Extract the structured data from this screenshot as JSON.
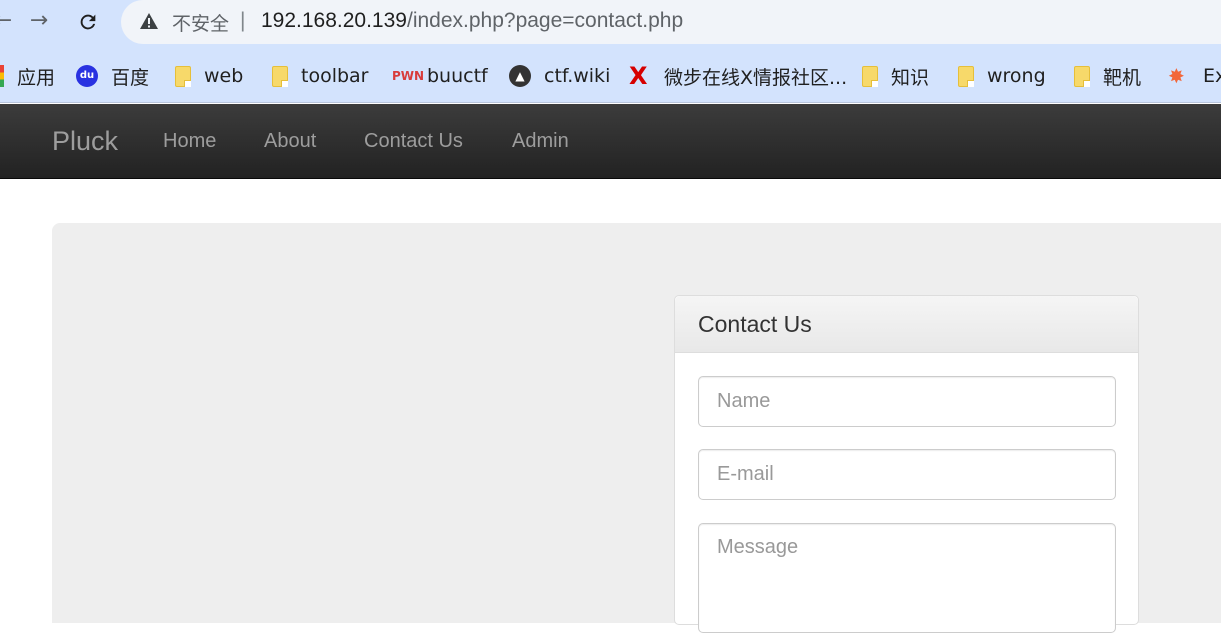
{
  "browser": {
    "security_label": "不安全",
    "url_host": "192.168.20.139",
    "url_path": "/index.php?page=contact.php",
    "bookmarks": [
      {
        "label": "应用",
        "icon": "apps-icon"
      },
      {
        "label": "百度",
        "icon": "baidu-icon"
      },
      {
        "label": "web",
        "icon": "folder-icon"
      },
      {
        "label": "toolbar",
        "icon": "folder-icon"
      },
      {
        "label": "buuctf",
        "icon": "buuctf-icon"
      },
      {
        "label": "ctf.wiki",
        "icon": "ctfwiki-icon"
      },
      {
        "label": "微步在线X情报社区...",
        "icon": "threatbook-icon"
      },
      {
        "label": "知识",
        "icon": "folder-icon"
      },
      {
        "label": "wrong",
        "icon": "folder-icon"
      },
      {
        "label": "靶机",
        "icon": "folder-icon"
      },
      {
        "label": "Ex",
        "icon": "burst-icon"
      }
    ]
  },
  "site": {
    "brand": "Pluck",
    "nav": [
      "Home",
      "About",
      "Contact Us",
      "Admin"
    ]
  },
  "contact": {
    "title": "Contact Us",
    "name_placeholder": "Name",
    "email_placeholder": "E-mail",
    "message_placeholder": "Message"
  }
}
